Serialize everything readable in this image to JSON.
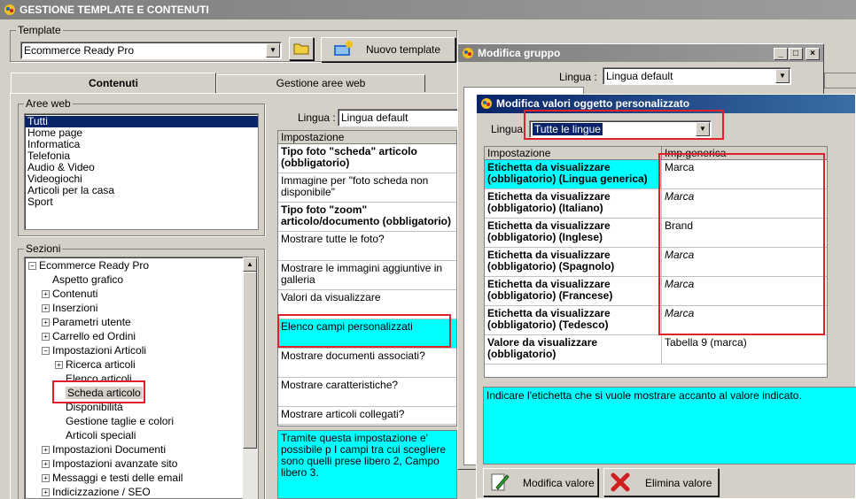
{
  "main_window": {
    "title": "GESTIONE TEMPLATE E CONTENUTI",
    "template_label": "Template",
    "template_value": "Ecommerce Ready Pro",
    "new_template_label": "Nuovo template",
    "tabs": [
      "Contenuti",
      "Gestione aree web"
    ],
    "aree_web_label": "Aree web",
    "aree_web": [
      "Tutti",
      "Home page",
      "Informatica",
      "Telefonia",
      "Audio & Video",
      "Videogiochi",
      "Articoli per la casa",
      "Sport"
    ],
    "sezioni_label": "Sezioni",
    "tree": [
      {
        "label": "Ecommerce Ready Pro",
        "prefix": "minus",
        "level": 0
      },
      {
        "label": "Aspetto grafico",
        "prefix": "",
        "level": 1
      },
      {
        "label": "Contenuti",
        "prefix": "plus",
        "level": 1
      },
      {
        "label": "Inserzioni",
        "prefix": "plus",
        "level": 1
      },
      {
        "label": "Parametri utente",
        "prefix": "plus",
        "level": 1
      },
      {
        "label": "Carrello ed Ordini",
        "prefix": "plus",
        "level": 1
      },
      {
        "label": "Impostazioni Articoli",
        "prefix": "minus",
        "level": 1
      },
      {
        "label": "Ricerca articoli",
        "prefix": "plus",
        "level": 2
      },
      {
        "label": "Elenco articoli",
        "prefix": "",
        "level": 2
      },
      {
        "label": "Scheda articolo",
        "prefix": "",
        "level": 2
      },
      {
        "label": "Disponibilità",
        "prefix": "",
        "level": 2
      },
      {
        "label": "Gestione taglie e colori",
        "prefix": "",
        "level": 2
      },
      {
        "label": "Articoli speciali",
        "prefix": "",
        "level": 2
      },
      {
        "label": "Impostazioni Documenti",
        "prefix": "plus",
        "level": 1
      },
      {
        "label": "Impostazioni avanzate sito",
        "prefix": "plus",
        "level": 1
      },
      {
        "label": "Messaggi e testi delle email",
        "prefix": "plus",
        "level": 1
      },
      {
        "label": "Indicizzazione / SEO",
        "prefix": "plus",
        "level": 1
      }
    ],
    "lingua_label": "Lingua :",
    "lingua_value": "Lingua default",
    "impostazione_header": "Impostazione",
    "settings": [
      {
        "label": "Tipo foto \"scheda\" articolo (obbligatorio)",
        "bold": true
      },
      {
        "label": "Immagine per \"foto scheda non disponibile\"",
        "bold": false
      },
      {
        "label": "Tipo foto \"zoom\" articolo/documento (obbligatorio)",
        "bold": true
      },
      {
        "label": "Mostrare tutte le foto?",
        "bold": false
      },
      {
        "label": "Mostrare le immagini aggiuntive in galleria",
        "bold": false
      },
      {
        "label": "Valori da visualizzare",
        "bold": false
      },
      {
        "label": "Elenco campi personalizzati",
        "bold": false
      },
      {
        "label": "Mostrare documenti associati?",
        "bold": false
      },
      {
        "label": "Mostrare caratteristiche?",
        "bold": false
      },
      {
        "label": "Mostrare articoli collegati?",
        "bold": false
      }
    ],
    "description": "Tramite questa impostazione e' possibile p I campi tra cui scegliere sono quelli prese libero 2, Campo libero 3."
  },
  "modifica_gruppo": {
    "title": "Modifica gruppo",
    "lingua_label": "Lingua :",
    "lingua_value": "Lingua default"
  },
  "modifica_valori": {
    "title": "Modifica valori oggetto personalizzato",
    "lingua_label": "Lingua",
    "lingua_value": "Tutte le lingue",
    "col_impostazione": "Impostazione",
    "col_value": "Imp.generica",
    "rows": [
      {
        "label": "Etichetta da visualizzare (obbligatorio) (Lingua generica)",
        "value": "Marca",
        "italic": false,
        "selected": true
      },
      {
        "label": "Etichetta da visualizzare (obbligatorio) (Italiano)",
        "value": "Marca",
        "italic": true,
        "selected": false
      },
      {
        "label": "Etichetta da visualizzare (obbligatorio) (Inglese)",
        "value": "Brand",
        "italic": false,
        "selected": false
      },
      {
        "label": "Etichetta da visualizzare (obbligatorio) (Spagnolo)",
        "value": "Marca",
        "italic": true,
        "selected": false
      },
      {
        "label": "Etichetta da visualizzare (obbligatorio) (Francese)",
        "value": "Marca",
        "italic": true,
        "selected": false
      },
      {
        "label": "Etichetta da visualizzare (obbligatorio) (Tedesco)",
        "value": "Marca",
        "italic": true,
        "selected": false
      },
      {
        "label": "Valore da visualizzare (obbligatorio)",
        "value": "Tabella 9 (marca)",
        "italic": false,
        "selected": false
      }
    ],
    "description": "Indicare l'etichetta che si vuole mostrare accanto al valore indicato.",
    "btn_modifica": "Modifica valore",
    "btn_elimina": "Elimina valore"
  },
  "colors": {
    "highlight": "#00ffff",
    "annotation": "#e0202a",
    "selection": "#0a246a"
  }
}
